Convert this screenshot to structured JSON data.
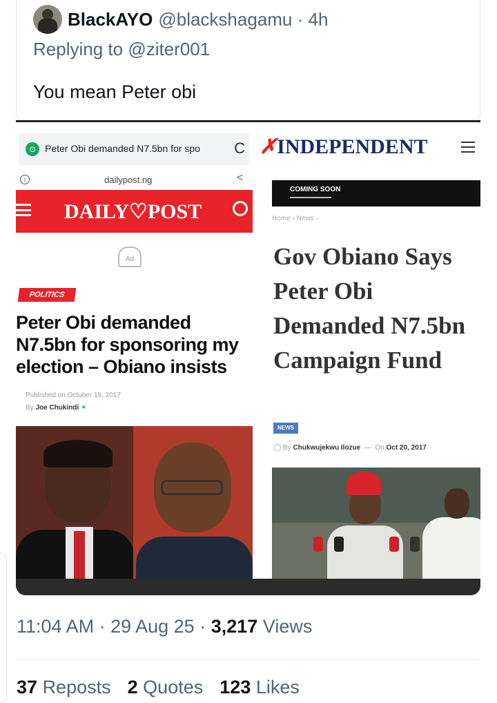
{
  "tweet": {
    "display_name": "BlackAYO",
    "handle": "@blackshagamu",
    "time_ago": "4h",
    "replying_prefix": "Replying to",
    "replying_to": "@ziter001",
    "text": "You mean Peter obi"
  },
  "media": {
    "left": {
      "browser_title": "Peter Obi demanded N7.5bn for spo",
      "domain": "dailypost.ng",
      "logo": "DAILY♡POST",
      "category": "POLITICS",
      "headline": "Peter Obi demanded N7.5bn for sponsoring my election – Obiano insists",
      "published": "Published on October 19, 2017",
      "author_prefix": "By",
      "author": "Joe Chukindi"
    },
    "right": {
      "logo": "INDEPENDENT",
      "banner_title": "COMING SOON",
      "breadcrumb": "Home › News ›",
      "headline": "Gov Obiano Says Peter Obi Demanded N7.5bn Campaign Fund",
      "badge": "NEWS",
      "author_prefix": "By",
      "author": "Chukwujekwu Ilozue",
      "date_prefix": "On",
      "date": "Oct 20, 2017"
    }
  },
  "meta": {
    "time": "11:04 AM",
    "date": "29 Aug 25",
    "views_count": "3,217",
    "views_label": "Views"
  },
  "stats": {
    "reposts_count": "37",
    "reposts_label": "Reposts",
    "quotes_count": "2",
    "quotes_label": "Quotes",
    "likes_count": "123",
    "likes_label": "Likes"
  },
  "colors": {
    "dailypost_red": "#e8232a",
    "independent_blue": "#1a2a6c",
    "secondary_text": "#536471"
  }
}
